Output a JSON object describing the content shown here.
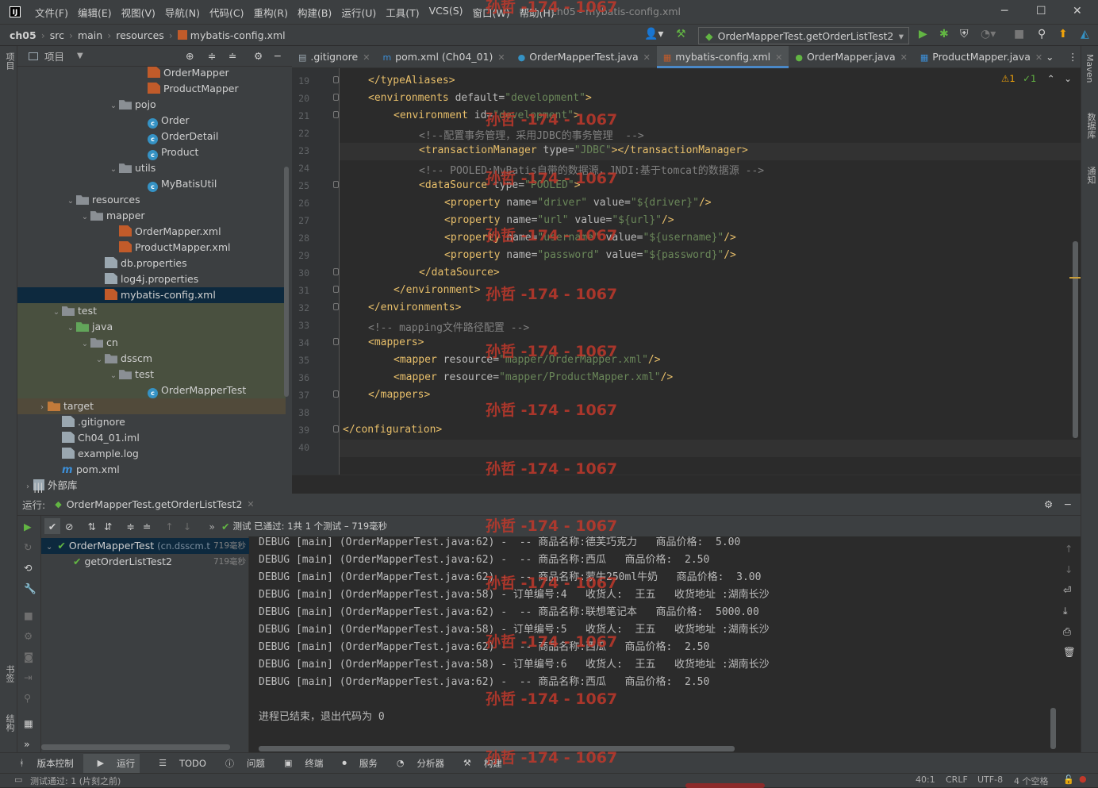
{
  "titlebar": {
    "menus": [
      "文件(F)",
      "编辑(E)",
      "视图(V)",
      "导航(N)",
      "代码(C)",
      "重构(R)",
      "构建(B)",
      "运行(U)",
      "工具(T)",
      "VCS(S)",
      "窗口(W)",
      "帮助(H)"
    ],
    "window_title": "ch05 - mybatis-config.xml"
  },
  "breadcrumbs": [
    "ch05",
    "src",
    "main",
    "resources",
    "mybatis-config.xml"
  ],
  "run_config": "OrderMapperTest.getOrderListTest2",
  "project_panel": {
    "title": "项目",
    "rows": [
      {
        "label": "OrderMapper",
        "indent": 150,
        "icon": "ico-xml",
        "arrow": ""
      },
      {
        "label": "ProductMapper",
        "indent": 150,
        "icon": "ico-xml",
        "arrow": ""
      },
      {
        "label": "pojo",
        "indent": 114,
        "icon": "ico-pkg",
        "arrow": "⌄"
      },
      {
        "label": "Order",
        "indent": 150,
        "icon": "ico-class",
        "arrow": ""
      },
      {
        "label": "OrderDetail",
        "indent": 150,
        "icon": "ico-class",
        "arrow": ""
      },
      {
        "label": "Product",
        "indent": 150,
        "icon": "ico-class",
        "arrow": ""
      },
      {
        "label": "utils",
        "indent": 114,
        "icon": "ico-pkg",
        "arrow": "⌄"
      },
      {
        "label": "MyBatisUtil",
        "indent": 150,
        "icon": "ico-class",
        "arrow": ""
      },
      {
        "label": "resources",
        "indent": 60,
        "icon": "ico-res",
        "arrow": "⌄"
      },
      {
        "label": "mapper",
        "indent": 78,
        "icon": "ico-folder",
        "arrow": "⌄"
      },
      {
        "label": "OrderMapper.xml",
        "indent": 114,
        "icon": "ico-xml",
        "arrow": ""
      },
      {
        "label": "ProductMapper.xml",
        "indent": 114,
        "icon": "ico-xml",
        "arrow": ""
      },
      {
        "label": "db.properties",
        "indent": 96,
        "icon": "ico-props",
        "arrow": ""
      },
      {
        "label": "log4j.properties",
        "indent": 96,
        "icon": "ico-props",
        "arrow": ""
      },
      {
        "label": "mybatis-config.xml",
        "indent": 96,
        "icon": "ico-xml",
        "arrow": "",
        "selected": true
      },
      {
        "label": "test",
        "indent": 42,
        "icon": "ico-folder",
        "arrow": "⌄",
        "green": true
      },
      {
        "label": "java",
        "indent": 60,
        "icon": "ico-green",
        "arrow": "⌄",
        "green": true
      },
      {
        "label": "cn",
        "indent": 78,
        "icon": "ico-pkg",
        "arrow": "⌄",
        "green": true
      },
      {
        "label": "dsscm",
        "indent": 96,
        "icon": "ico-pkg",
        "arrow": "⌄",
        "green": true
      },
      {
        "label": "test",
        "indent": 114,
        "icon": "ico-pkg",
        "arrow": "⌄",
        "green": true
      },
      {
        "label": "OrderMapperTest",
        "indent": 150,
        "icon": "ico-class",
        "arrow": "",
        "green": true
      },
      {
        "label": "target",
        "indent": 24,
        "icon": "ico-target",
        "arrow": "›",
        "target": true
      },
      {
        "label": ".gitignore",
        "indent": 42,
        "icon": "ico-file",
        "arrow": ""
      },
      {
        "label": "Ch04_01.iml",
        "indent": 42,
        "icon": "ico-file",
        "arrow": ""
      },
      {
        "label": "example.log",
        "indent": 42,
        "icon": "ico-file",
        "arrow": ""
      },
      {
        "label": "pom.xml",
        "indent": 42,
        "icon": "ico-m",
        "arrow": ""
      },
      {
        "label": "外部库",
        "indent": 6,
        "icon": "ico-lib",
        "arrow": "›"
      }
    ]
  },
  "tabs": [
    {
      "label": ".gitignore",
      "active": false
    },
    {
      "label": "pom.xml (Ch04_01)",
      "active": false
    },
    {
      "label": "OrderMapperTest.java",
      "active": false
    },
    {
      "label": "mybatis-config.xml",
      "active": true
    },
    {
      "label": "OrderMapper.java",
      "active": false
    },
    {
      "label": "ProductMapper.java",
      "active": false
    }
  ],
  "editor": {
    "inspections": {
      "warnings": "1",
      "typos": "1"
    },
    "lines": [
      {
        "n": "19",
        "ind": 4,
        "parts": [
          [
            "tag",
            "</typeAliases>"
          ]
        ]
      },
      {
        "n": "20",
        "ind": 4,
        "parts": [
          [
            "tag",
            "<environments "
          ],
          [
            "attr",
            "default="
          ],
          [
            "val",
            "\"development\""
          ],
          [
            "tag",
            ">"
          ]
        ]
      },
      {
        "n": "21",
        "ind": 8,
        "parts": [
          [
            "tag",
            "<environment "
          ],
          [
            "attr",
            "id="
          ],
          [
            "val",
            "\"development\""
          ],
          [
            "tag",
            ">"
          ]
        ]
      },
      {
        "n": "22",
        "ind": 12,
        "parts": [
          [
            "com",
            "<!--配置事务管理，采用JDBC的事务管理  -->"
          ]
        ]
      },
      {
        "n": "23",
        "ind": 12,
        "parts": [
          [
            "tag",
            "<transactionManager "
          ],
          [
            "attr",
            "type="
          ],
          [
            "val",
            "\"JDBC\""
          ],
          [
            "tag",
            "></transactionManager>"
          ]
        ],
        "hl": true
      },
      {
        "n": "24",
        "ind": 12,
        "parts": [
          [
            "com",
            "<!-- POOLED:MyBatis自带的数据源，JNDI:基于tomcat的数据源 -->"
          ]
        ]
      },
      {
        "n": "25",
        "ind": 12,
        "parts": [
          [
            "tag",
            "<dataSource "
          ],
          [
            "attr",
            "type="
          ],
          [
            "val",
            "\"POOLED\""
          ],
          [
            "tag",
            ">"
          ]
        ]
      },
      {
        "n": "26",
        "ind": 16,
        "parts": [
          [
            "tag",
            "<property "
          ],
          [
            "attr",
            "name="
          ],
          [
            "val",
            "\"driver\" "
          ],
          [
            "attr",
            "value="
          ],
          [
            "val",
            "\"${driver}\""
          ],
          [
            "tag",
            "/>"
          ]
        ]
      },
      {
        "n": "27",
        "ind": 16,
        "parts": [
          [
            "tag",
            "<property "
          ],
          [
            "attr",
            "name="
          ],
          [
            "val",
            "\"url\" "
          ],
          [
            "attr",
            "value="
          ],
          [
            "val",
            "\"${url}\""
          ],
          [
            "tag",
            "/>"
          ]
        ]
      },
      {
        "n": "28",
        "ind": 16,
        "parts": [
          [
            "tag",
            "<property "
          ],
          [
            "attr",
            "name="
          ],
          [
            "val",
            "\"username\" "
          ],
          [
            "attr",
            "value="
          ],
          [
            "val",
            "\"${username}\""
          ],
          [
            "tag",
            "/>"
          ]
        ]
      },
      {
        "n": "29",
        "ind": 16,
        "parts": [
          [
            "tag",
            "<property "
          ],
          [
            "attr",
            "name="
          ],
          [
            "val",
            "\"password\" "
          ],
          [
            "attr",
            "value="
          ],
          [
            "val",
            "\"${password}\""
          ],
          [
            "tag",
            "/>"
          ]
        ]
      },
      {
        "n": "30",
        "ind": 12,
        "parts": [
          [
            "tag",
            "</dataSource>"
          ]
        ]
      },
      {
        "n": "31",
        "ind": 8,
        "parts": [
          [
            "tag",
            "</environment>"
          ]
        ]
      },
      {
        "n": "32",
        "ind": 4,
        "parts": [
          [
            "tag",
            "</environments>"
          ]
        ]
      },
      {
        "n": "33",
        "ind": 4,
        "parts": [
          [
            "com",
            "<!-- mapping文件路径配置 -->"
          ]
        ]
      },
      {
        "n": "34",
        "ind": 4,
        "parts": [
          [
            "tag",
            "<mappers>"
          ]
        ]
      },
      {
        "n": "35",
        "ind": 8,
        "parts": [
          [
            "tag",
            "<mapper "
          ],
          [
            "attr",
            "resource="
          ],
          [
            "val",
            "\"mapper/OrderMapper.xml\""
          ],
          [
            "tag",
            "/>"
          ]
        ]
      },
      {
        "n": "36",
        "ind": 8,
        "parts": [
          [
            "tag",
            "<mapper "
          ],
          [
            "attr",
            "resource="
          ],
          [
            "val",
            "\"mapper/ProductMapper.xml\""
          ],
          [
            "tag",
            "/>"
          ]
        ]
      },
      {
        "n": "37",
        "ind": 4,
        "parts": [
          [
            "tag",
            "</mappers>"
          ]
        ]
      },
      {
        "n": "38",
        "ind": 0,
        "parts": []
      },
      {
        "n": "39",
        "ind": 0,
        "parts": [
          [
            "tag",
            "</configuration>"
          ]
        ]
      },
      {
        "n": "40",
        "ind": 0,
        "parts": []
      }
    ]
  },
  "run": {
    "label": "运行:",
    "tab": "OrderMapperTest.getOrderListTest2",
    "status": "测试 已通过: 1共 1 个测试 – 719毫秒",
    "tree": [
      {
        "label": "OrderMapperTest",
        "sub": "(cn.dsscm.t",
        "time": "719毫秒"
      },
      {
        "label": "getOrderListTest2",
        "sub": "",
        "time": "719毫秒"
      }
    ],
    "console": [
      "DEBUG [main] (OrderMapperTest.java:62) -  -- 商品名称:德芙巧克力   商品价格:  5.00",
      "DEBUG [main] (OrderMapperTest.java:62) -  -- 商品名称:西瓜   商品价格:  2.50",
      "DEBUG [main] (OrderMapperTest.java:62) -  -- 商品名称:蒙牛250ml牛奶   商品价格:  3.00",
      "DEBUG [main] (OrderMapperTest.java:58) - 订单编号:4   收货人:  王五   收货地址 :湖南长沙",
      "DEBUG [main] (OrderMapperTest.java:62) -  -- 商品名称:联想笔记本   商品价格:  5000.00",
      "DEBUG [main] (OrderMapperTest.java:58) - 订单编号:5   收货人:  王五   收货地址 :湖南长沙",
      "DEBUG [main] (OrderMapperTest.java:62) -  -- 商品名称:西瓜   商品价格:  2.50",
      "DEBUG [main] (OrderMapperTest.java:58) - 订单编号:6   收货人:  王五   收货地址 :湖南长沙",
      "DEBUG [main] (OrderMapperTest.java:62) -  -- 商品名称:西瓜   商品价格:  2.50",
      "",
      "进程已结束，退出代码为 0"
    ]
  },
  "bottom_tabs": [
    "版本控制",
    "运行",
    "TODO",
    "问题",
    "终端",
    "服务",
    "分析器",
    "构建"
  ],
  "status": {
    "left": "测试通过: 1 (片刻之前)",
    "pos": "40:1",
    "sep": "CRLF",
    "enc": "UTF-8",
    "indent": "4 个空格"
  },
  "side": {
    "left_top": "项目",
    "left_bottom1": "书签",
    "left_bottom2": "结构",
    "right1": "Maven",
    "right2": "数据库",
    "right3": "通知"
  },
  "watermark": "孙哲 -174 - 1067"
}
